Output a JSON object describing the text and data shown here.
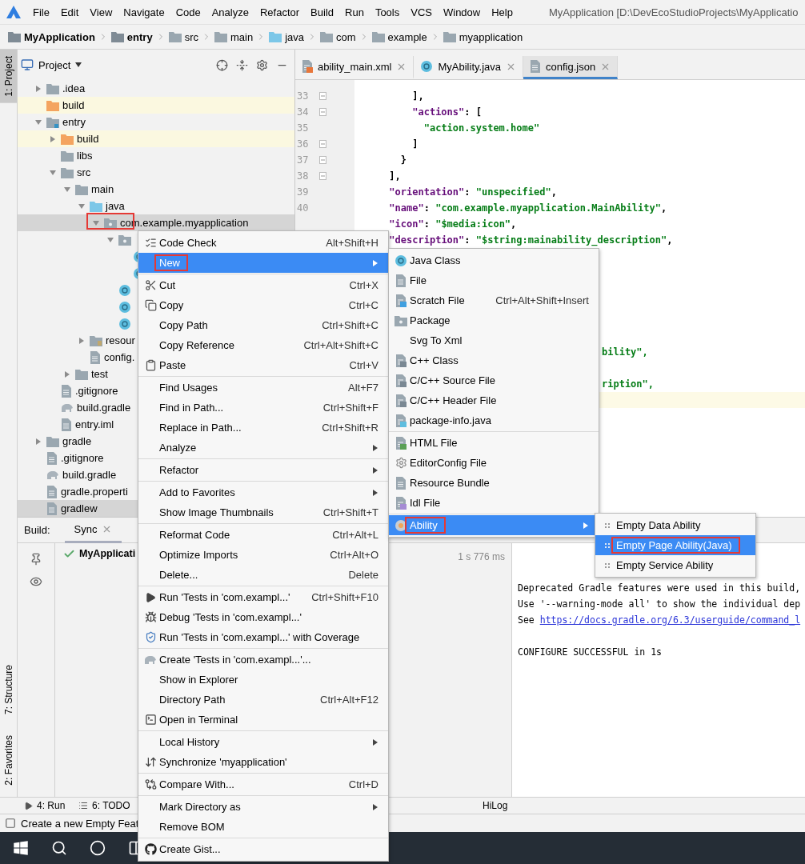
{
  "menu_bar": {
    "items": [
      "File",
      "Edit",
      "View",
      "Navigate",
      "Code",
      "Analyze",
      "Refactor",
      "Build",
      "Run",
      "Tools",
      "VCS",
      "Window",
      "Help"
    ],
    "title": "MyApplication [D:\\DevEcoStudioProjects\\MyApplicatio"
  },
  "breadcrumbs": [
    {
      "label": "MyApplication",
      "bold": true,
      "color": "#7f8b95"
    },
    {
      "label": "entry",
      "bold": true,
      "color": "#7f8b95"
    },
    {
      "label": "src",
      "bold": false,
      "color": "#9aa7b0"
    },
    {
      "label": "main",
      "bold": false,
      "color": "#9aa7b0"
    },
    {
      "label": "java",
      "bold": false,
      "color": "#7cc7e8"
    },
    {
      "label": "com",
      "bold": false,
      "color": "#9aa7b0"
    },
    {
      "label": "example",
      "bold": false,
      "color": "#9aa7b0"
    },
    {
      "label": "myapplication",
      "bold": false,
      "color": "#9aa7b0"
    }
  ],
  "left_stripe": {
    "top": [
      {
        "label": "1: Project",
        "selected": true
      }
    ],
    "bottom": [
      {
        "label": "7: Structure",
        "selected": false
      },
      {
        "label": "2: Favorites",
        "selected": false
      }
    ]
  },
  "project_panel": {
    "title": "Project",
    "tree": [
      {
        "label": ".idea",
        "kind": "folder",
        "color": "#9aa7b0",
        "expanded": false,
        "selected": false,
        "highlighted": false
      },
      {
        "label": "build",
        "kind": "folder",
        "color": "#f4a460",
        "selected": false,
        "highlighted": true
      },
      {
        "label": "entry",
        "kind": "module",
        "color": "#9aa7b0",
        "expanded": true,
        "selected": false,
        "highlighted": false,
        "children": [
          {
            "label": "build",
            "kind": "folder",
            "color": "#f4a460",
            "expanded": false,
            "selected": false,
            "highlighted": true
          },
          {
            "label": "libs",
            "kind": "folder",
            "color": "#9aa7b0",
            "selected": false,
            "highlighted": false
          },
          {
            "label": "src",
            "kind": "folder",
            "color": "#9aa7b0",
            "expanded": true,
            "selected": false,
            "highlighted": false,
            "children": [
              {
                "label": "main",
                "kind": "folder",
                "color": "#9aa7b0",
                "expanded": true,
                "selected": false,
                "highlighted": false,
                "children": [
                  {
                    "label": "java",
                    "kind": "folder",
                    "color": "#7cc7e8",
                    "expanded": true,
                    "selected": false,
                    "highlighted": false,
                    "children": [
                      {
                        "label": "com.example.myapplication",
                        "kind": "package",
                        "color": "#9aa7b0",
                        "expanded": true,
                        "selected": true,
                        "annotated": true,
                        "children": [
                          {
                            "kind": "package",
                            "color": "#9aa7b0",
                            "expanded": true,
                            "selected": false,
                            "highlighted": false,
                            "children": [
                              {
                                "kind": "class",
                                "selected": false
                              },
                              {
                                "kind": "class",
                                "selected": false
                              }
                            ]
                          },
                          {
                            "kind": "class",
                            "selected": false
                          },
                          {
                            "kind": "class",
                            "selected": false
                          },
                          {
                            "kind": "class",
                            "selected": false
                          }
                        ]
                      }
                    ]
                  },
                  {
                    "label": "resour",
                    "kind": "resources",
                    "color": "#9aa7b0",
                    "expanded": false,
                    "selected": false,
                    "highlighted": false
                  },
                  {
                    "label": "config.",
                    "kind": "file",
                    "selected": false
                  }
                ]
              },
              {
                "label": "test",
                "kind": "folder",
                "color": "#9aa7b0",
                "expanded": false,
                "selected": false,
                "highlighted": false
              }
            ]
          },
          {
            "label": ".gitignore",
            "kind": "file",
            "selected": false
          },
          {
            "label": "build.gradle",
            "kind": "gradle",
            "selected": false
          },
          {
            "label": "entry.iml",
            "kind": "file",
            "selected": false
          }
        ]
      },
      {
        "label": "gradle",
        "kind": "folder",
        "color": "#9aa7b0",
        "expanded": false,
        "selected": false,
        "highlighted": false
      },
      {
        "label": ".gitignore",
        "kind": "file",
        "selected": false
      },
      {
        "label": "build.gradle",
        "kind": "gradle",
        "selected": false
      },
      {
        "label": "gradle.properti",
        "kind": "file",
        "selected": false
      },
      {
        "label": "gradlew",
        "kind": "file",
        "selected": true
      }
    ]
  },
  "editor": {
    "tabs": [
      {
        "label": "ability_main.xml",
        "kind": "xml",
        "selected": false
      },
      {
        "label": "MyAbility.java",
        "kind": "class",
        "selected": false
      },
      {
        "label": "config.json",
        "kind": "json",
        "selected": true
      }
    ],
    "lines": [
      {
        "number": "33",
        "fold": true,
        "text": "          ],",
        "kind": "code",
        "highlighted": false
      },
      {
        "number": "34",
        "fold": true,
        "text": "          \"actions\": [",
        "kind": "code",
        "highlighted": false
      },
      {
        "number": "35",
        "fold": false,
        "text": "            \"action.system.home\"",
        "kind": "code",
        "highlighted": false
      },
      {
        "number": "36",
        "fold": true,
        "text": "          ]",
        "kind": "code",
        "highlighted": false
      },
      {
        "number": "37",
        "fold": true,
        "text": "        }",
        "kind": "code",
        "highlighted": false
      },
      {
        "number": "38",
        "fold": true,
        "text": "      ],",
        "kind": "code",
        "highlighted": false
      },
      {
        "number": "39",
        "fold": false,
        "text": "      \"orientation\": \"unspecified\",",
        "kind": "code",
        "highlighted": false
      },
      {
        "number": "40",
        "fold": false,
        "text": "      \"name\": \"com.example.myapplication.MainAbility\",",
        "kind": "code",
        "highlighted": false
      },
      {
        "text": "      \"icon\": \"$media:icon\",",
        "kind": "code",
        "highlighted": false
      },
      {
        "text": "      \"description\": \"$string:mainability_description\",",
        "kind": "code",
        "highlighted": false
      },
      {
        "highlighted": false
      },
      {
        "highlighted": false
      },
      {
        "highlighted": false
      },
      {
        "highlighted": false
      },
      {
        "highlighted": false
      },
      {
        "highlighted": false
      },
      {
        "text": "bility\",",
        "kind": "fragment",
        "highlighted": false
      },
      {
        "highlighted": false
      },
      {
        "text": "ription\",",
        "kind": "fragment",
        "highlighted": false
      },
      {
        "highlighted": true
      }
    ]
  },
  "build_panel": {
    "label": "Build:",
    "tabs": [
      {
        "label": "Sync",
        "selected": true
      }
    ],
    "tree_item": "MyApplicati",
    "duration": "1 s 776 ms",
    "console": [
      {
        "kind": "text",
        "text": "Deprecated Gradle features were used in this build,"
      },
      {
        "kind": "text",
        "text": "Use '--warning-mode all' to show the individual dep"
      },
      {
        "kind": "link",
        "text": "See",
        "link": "https://docs.gradle.org/6.3/userguide/command_l"
      },
      {
        "kind": "result",
        "text": "CONFIGURE SUCCESSFUL in 1s"
      }
    ]
  },
  "tool_window_bar": [
    {
      "label": "4: Run",
      "kind": "run"
    },
    {
      "label": "6: TODO",
      "kind": "todo"
    },
    {
      "label": "HiLog",
      "kind": "plain"
    }
  ],
  "status_bar": {
    "text": "Create a new Empty Feat"
  },
  "context_menu": {
    "items": [
      {
        "kind": "item",
        "label": "Code Check",
        "shortcut": "Alt+Shift+H",
        "selected": false
      },
      {
        "kind": "item",
        "label": "New",
        "submenu": true,
        "selected": true,
        "annotated": true
      },
      {
        "kind": "separator"
      },
      {
        "kind": "item",
        "label": "Cut",
        "shortcut": "Ctrl+X",
        "selected": false
      },
      {
        "kind": "item",
        "label": "Copy",
        "shortcut": "Ctrl+C",
        "selected": false
      },
      {
        "kind": "item",
        "label": "Copy Path",
        "shortcut": "Ctrl+Shift+C",
        "selected": false
      },
      {
        "kind": "item",
        "label": "Copy Reference",
        "shortcut": "Ctrl+Alt+Shift+C",
        "selected": false
      },
      {
        "kind": "item",
        "label": "Paste",
        "shortcut": "Ctrl+V",
        "selected": false
      },
      {
        "kind": "separator"
      },
      {
        "kind": "item",
        "label": "Find Usages",
        "shortcut": "Alt+F7",
        "selected": false
      },
      {
        "kind": "item",
        "label": "Find in Path...",
        "shortcut": "Ctrl+Shift+F",
        "selected": false
      },
      {
        "kind": "item",
        "label": "Replace in Path...",
        "shortcut": "Ctrl+Shift+R",
        "selected": false
      },
      {
        "kind": "item",
        "label": "Analyze",
        "submenu": true,
        "selected": false
      },
      {
        "kind": "separator"
      },
      {
        "kind": "item",
        "label": "Refactor",
        "submenu": true,
        "selected": false
      },
      {
        "kind": "separator"
      },
      {
        "kind": "item",
        "label": "Add to Favorites",
        "submenu": true,
        "selected": false
      },
      {
        "kind": "item",
        "label": "Show Image Thumbnails",
        "shortcut": "Ctrl+Shift+T",
        "selected": false
      },
      {
        "kind": "separator"
      },
      {
        "kind": "item",
        "label": "Reformat Code",
        "shortcut": "Ctrl+Alt+L",
        "selected": false
      },
      {
        "kind": "item",
        "label": "Optimize Imports",
        "shortcut": "Ctrl+Alt+O",
        "selected": false
      },
      {
        "kind": "item",
        "label": "Delete...",
        "shortcut": "Delete",
        "selected": false
      },
      {
        "kind": "separator"
      },
      {
        "kind": "item",
        "label": "Run 'Tests in 'com.exampl...'",
        "shortcut": "Ctrl+Shift+F10",
        "selected": false
      },
      {
        "kind": "item",
        "label": "Debug 'Tests in 'com.exampl...'",
        "selected": false
      },
      {
        "kind": "item",
        "label": "Run 'Tests in 'com.exampl...' with Coverage",
        "selected": false
      },
      {
        "kind": "separator"
      },
      {
        "kind": "item",
        "label": "Create 'Tests in 'com.exampl...'...",
        "selected": false
      },
      {
        "kind": "item",
        "label": "Show in Explorer",
        "selected": false
      },
      {
        "kind": "item",
        "label": "Directory Path",
        "shortcut": "Ctrl+Alt+F12",
        "selected": false
      },
      {
        "kind": "item",
        "label": "Open in Terminal",
        "selected": false
      },
      {
        "kind": "separator"
      },
      {
        "kind": "item",
        "label": "Local History",
        "submenu": true,
        "selected": false
      },
      {
        "kind": "item",
        "label": "Synchronize 'myapplication'",
        "selected": false
      },
      {
        "kind": "separator"
      },
      {
        "kind": "item",
        "label": "Compare With...",
        "shortcut": "Ctrl+D",
        "selected": false
      },
      {
        "kind": "separator"
      },
      {
        "kind": "item",
        "label": "Mark Directory as",
        "submenu": true,
        "selected": false
      },
      {
        "kind": "item",
        "label": "Remove BOM",
        "selected": false
      },
      {
        "kind": "separator"
      },
      {
        "kind": "item",
        "label": "Create Gist...",
        "selected": false
      }
    ]
  },
  "new_submenu": {
    "items": [
      {
        "kind": "item",
        "label": "Java Class",
        "selected": false
      },
      {
        "kind": "item",
        "label": "File",
        "selected": false
      },
      {
        "kind": "item",
        "label": "Scratch File",
        "shortcut": "Ctrl+Alt+Shift+Insert",
        "selected": false
      },
      {
        "kind": "item",
        "label": "Package",
        "selected": false
      },
      {
        "kind": "item",
        "label": "Svg To Xml",
        "selected": false
      },
      {
        "kind": "item",
        "label": "C++ Class",
        "selected": false
      },
      {
        "kind": "item",
        "label": "C/C++ Source File",
        "selected": false
      },
      {
        "kind": "item",
        "label": "C/C++ Header File",
        "selected": false
      },
      {
        "kind": "item",
        "label": "package-info.java",
        "selected": false
      },
      {
        "kind": "separator"
      },
      {
        "kind": "item",
        "label": "HTML File",
        "selected": false
      },
      {
        "kind": "item",
        "label": "EditorConfig File",
        "selected": false
      },
      {
        "kind": "item",
        "label": "Resource Bundle",
        "selected": false
      },
      {
        "kind": "item",
        "label": "Idl File",
        "selected": false
      },
      {
        "kind": "separator"
      },
      {
        "kind": "item",
        "label": "Ability",
        "submenu": true,
        "selected": true,
        "annotated": true
      }
    ]
  },
  "ability_submenu": {
    "items": [
      {
        "kind": "item",
        "label": "Empty Data Ability",
        "selected": false
      },
      {
        "kind": "item",
        "label": "Empty Page Ability(Java)",
        "selected": true,
        "annotated": true
      },
      {
        "kind": "item",
        "label": "Empty Service Ability",
        "selected": false
      }
    ]
  }
}
